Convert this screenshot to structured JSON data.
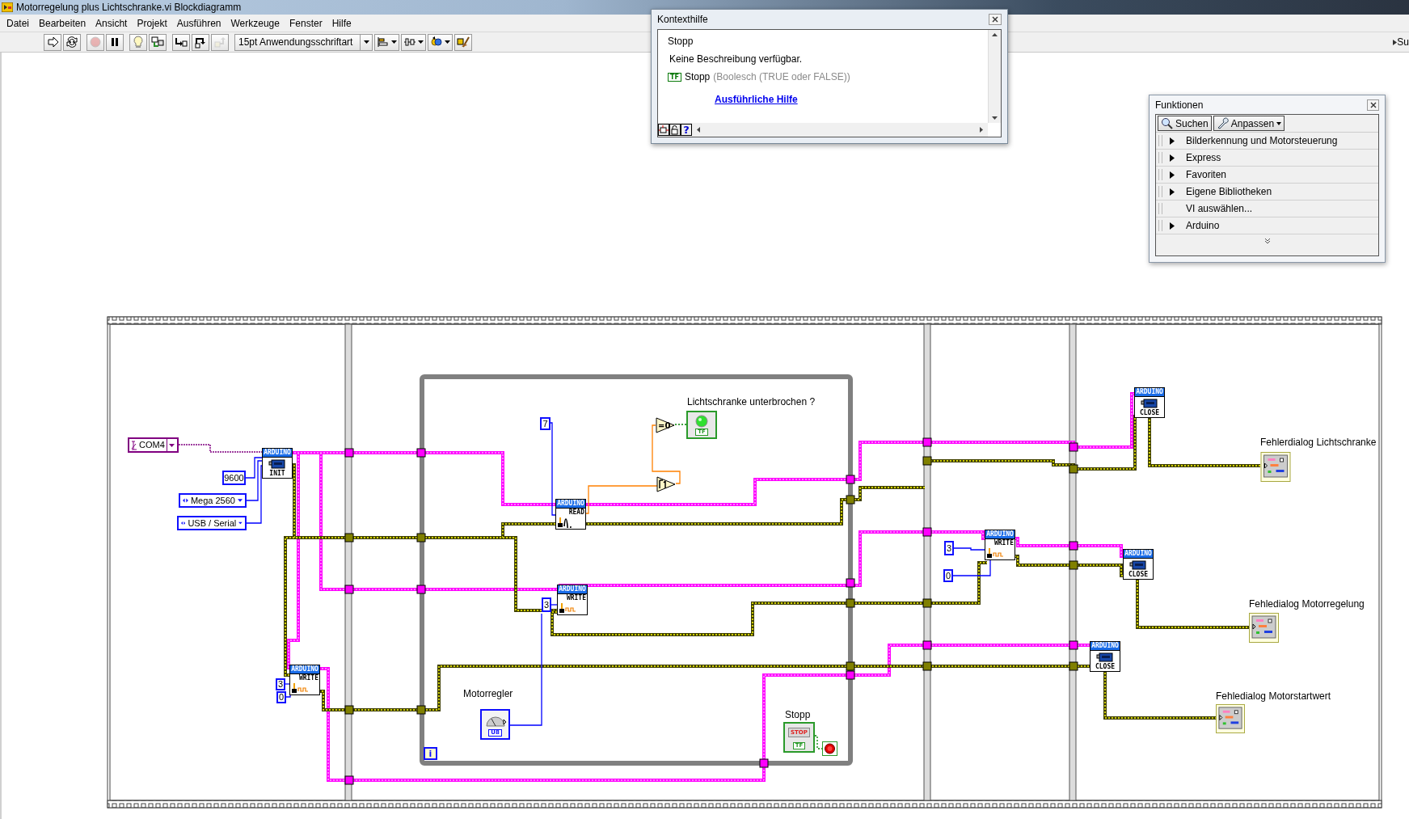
{
  "window": {
    "title": "Motorregelung plus Lichtschranke.vi Blockdiagramm"
  },
  "menu": [
    "Datei",
    "Bearbeiten",
    "Ansicht",
    "Projekt",
    "Ausführen",
    "Werkzeuge",
    "Fenster",
    "Hilfe"
  ],
  "toolbar": {
    "buttons": [
      {
        "kind": "run",
        "disabled": false
      },
      {
        "kind": "run_continuously",
        "disabled": false
      },
      {
        "kind": "abort",
        "disabled": true
      },
      {
        "kind": "pause",
        "disabled": false
      },
      {
        "kind": "highlight",
        "disabled": false
      },
      {
        "kind": "retain",
        "disabled": false
      },
      {
        "kind": "step_into",
        "disabled": false
      },
      {
        "kind": "step_over",
        "disabled": false
      },
      {
        "kind": "step_out",
        "disabled": true
      }
    ],
    "font": "15pt Anwendungsschriftart",
    "tools": [
      {
        "kind": "align"
      },
      {
        "kind": "distribute"
      },
      {
        "kind": "reorder"
      },
      {
        "kind": "cleanup"
      }
    ],
    "search": "Su"
  },
  "context_help": {
    "title": "Kontexthilfe",
    "heading": "Stopp",
    "description": "Keine Beschreibung verfügbar.",
    "terminal_tag": "TF",
    "terminal": "Stopp",
    "terminal_type": "(Boolesch (TRUE oder FALSE))",
    "link": "Ausführliche Hilfe",
    "buttons": [
      {
        "kind": "diagram"
      },
      {
        "kind": "lock"
      },
      {
        "kind": "help",
        "label": "?"
      }
    ]
  },
  "functions_palette": {
    "title": "Funktionen",
    "buttons": [
      {
        "kind": "search",
        "label": "Suchen"
      },
      {
        "kind": "customize",
        "label": "Anpassen"
      }
    ],
    "categories": [
      {
        "label": "Bilderkennung und Motorsteuerung",
        "expandable": true
      },
      {
        "label": "Express",
        "expandable": true
      },
      {
        "label": "Favoriten",
        "expandable": true
      },
      {
        "label": "Eigene Bibliotheken",
        "expandable": true
      },
      {
        "label": "VI auswählen...",
        "expandable": false
      },
      {
        "label": "Arduino",
        "expandable": true
      }
    ]
  },
  "diagram": {
    "constants": [
      {
        "kind": "resource",
        "value": "COM4"
      },
      {
        "kind": "numeric",
        "value": "9600"
      },
      {
        "kind": "enum",
        "value": "Mega 2560"
      },
      {
        "kind": "enum",
        "value": "USB / Serial"
      },
      {
        "kind": "numeric",
        "value": "3"
      },
      {
        "kind": "numeric",
        "value": "0"
      },
      {
        "kind": "numeric",
        "value": "7"
      },
      {
        "kind": "numeric",
        "value": "3"
      },
      {
        "kind": "numeric",
        "value": "3"
      },
      {
        "kind": "numeric",
        "value": "0"
      }
    ],
    "nodes": [
      {
        "kind": "board",
        "banner": "ARDUINO",
        "label": "INIT"
      },
      {
        "kind": "write",
        "banner": "ARDUINO",
        "label": "WRITE"
      },
      {
        "kind": "read",
        "banner": "ARDUINO",
        "label": "READ"
      },
      {
        "kind": "write",
        "banner": "ARDUINO",
        "label": "WRITE"
      },
      {
        "kind": "write",
        "banner": "ARDUINO",
        "label": "WRITE"
      },
      {
        "kind": "board",
        "banner": "ARDUINO",
        "label": "CLOSE"
      },
      {
        "kind": "board",
        "banner": "ARDUINO",
        "label": "CLOSE"
      },
      {
        "kind": "board",
        "banner": "ARDUINO",
        "label": "CLOSE"
      }
    ],
    "primitives": [
      {
        "kind": "equal_zero",
        "label": "=0"
      },
      {
        "kind": "index"
      }
    ],
    "terminals": [
      {
        "kind": "led",
        "label": "Lichtschranke unterbrochen ?",
        "tag": "TF",
        "on": true
      },
      {
        "kind": "knob",
        "label": "Motorregler",
        "tag": "U8"
      },
      {
        "kind": "stop_button",
        "label": "Stopp",
        "button": "STOP",
        "tag": "TF"
      },
      {
        "kind": "dialog",
        "label": "Fehlerdialog Lichtschranke"
      },
      {
        "kind": "dialog",
        "label": "Fehledialog Motorregelung"
      },
      {
        "kind": "dialog",
        "label": "Fehledialog Motorstartwert"
      }
    ],
    "loop": {
      "iteration": "i"
    }
  }
}
